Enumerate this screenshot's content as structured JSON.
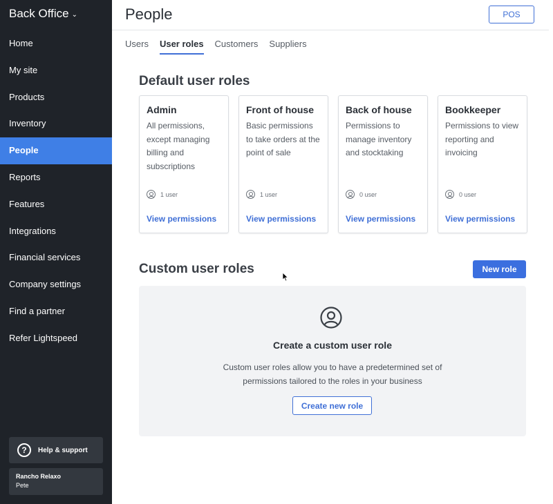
{
  "sidebar": {
    "brand": "Back Office",
    "items": [
      {
        "label": "Home"
      },
      {
        "label": "My site"
      },
      {
        "label": "Products"
      },
      {
        "label": "Inventory"
      },
      {
        "label": "People"
      },
      {
        "label": "Reports"
      },
      {
        "label": "Features"
      },
      {
        "label": "Integrations"
      },
      {
        "label": "Financial services"
      },
      {
        "label": "Company settings"
      },
      {
        "label": "Find a partner"
      },
      {
        "label": "Refer Lightspeed"
      }
    ],
    "active_item": "People",
    "help_label": "Help & support",
    "account": {
      "name": "Rancho Relaxo",
      "user": "Pete"
    }
  },
  "header": {
    "title": "People",
    "pos_label": "POS"
  },
  "tabs": [
    {
      "label": "Users"
    },
    {
      "label": "User roles"
    },
    {
      "label": "Customers"
    },
    {
      "label": "Suppliers"
    }
  ],
  "active_tab": "User roles",
  "default_roles": {
    "title": "Default user roles",
    "cards": [
      {
        "title": "Admin",
        "description": "All permissions, except managing billing and subscriptions",
        "users": "1 user",
        "link": "View permissions"
      },
      {
        "title": "Front of house",
        "description": "Basic permissions to take orders at the point of sale",
        "users": "1 user",
        "link": "View permissions"
      },
      {
        "title": "Back of house",
        "description": "Permissions to manage inventory and stocktaking",
        "users": "0 user",
        "link": "View permissions"
      },
      {
        "title": "Bookkeeper",
        "description": "Permissions to view reporting and invoicing",
        "users": "0 user",
        "link": "View permissions"
      }
    ]
  },
  "custom_roles": {
    "title": "Custom user roles",
    "new_role_label": "New role",
    "empty_title": "Create a custom user role",
    "empty_description": "Custom user roles allow you to have a predetermined set of permissions tailored to the roles in your business",
    "create_label": "Create new role"
  },
  "colors": {
    "sidebar_bg": "#1f2329",
    "active_nav": "#3f7fe6",
    "accent": "#3f6fd6"
  }
}
